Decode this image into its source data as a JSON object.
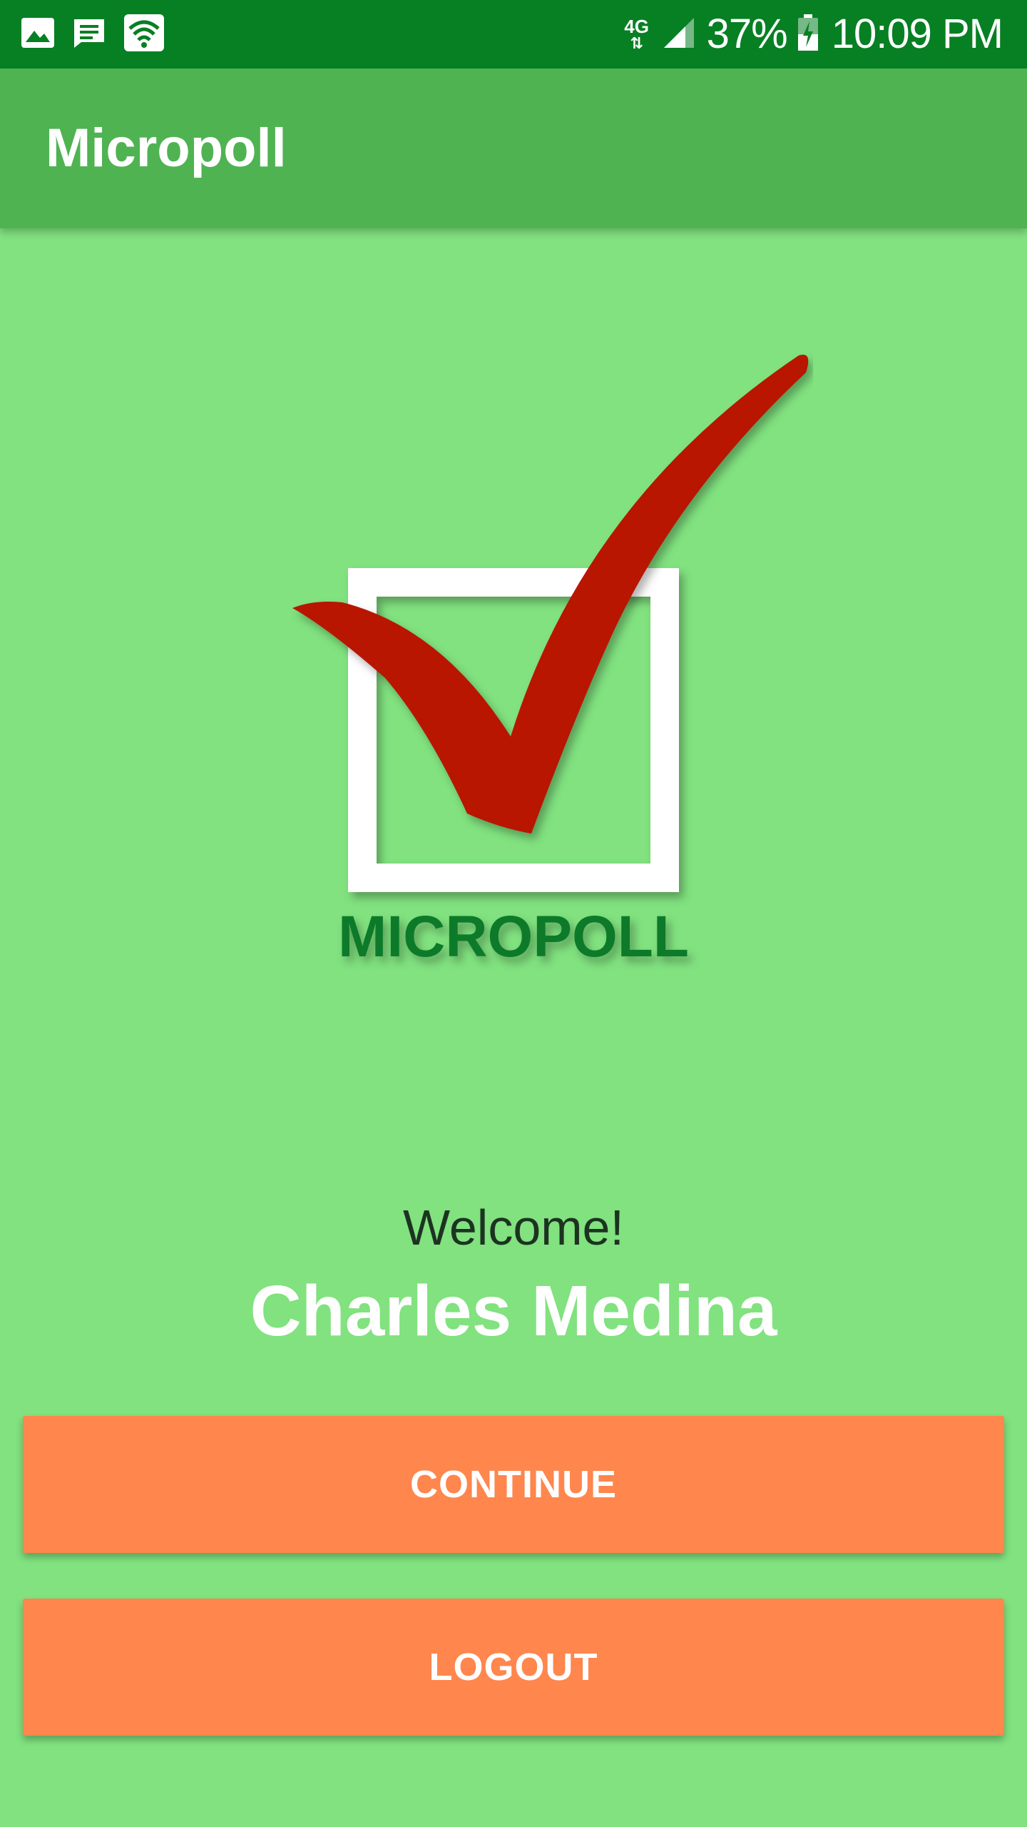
{
  "status_bar": {
    "icons_left": [
      "image-icon",
      "message-icon",
      "wifi-hotspot-icon"
    ],
    "network": "4G",
    "battery_percent": "37%",
    "time": "10:09 PM"
  },
  "app_bar": {
    "title": "Micropoll"
  },
  "logo": {
    "text": "MICROPOLL"
  },
  "welcome": {
    "greeting": "Welcome!",
    "user_name": "Charles Medina"
  },
  "buttons": {
    "continue_label": "CONTINUE",
    "logout_label": "LOGOUT"
  },
  "colors": {
    "background": "#81e27f",
    "status_bar": "#077f23",
    "app_bar": "#4fb352",
    "button": "#ff864d",
    "checkmark": "#b81400",
    "logo_text": "#0a7a2a"
  }
}
